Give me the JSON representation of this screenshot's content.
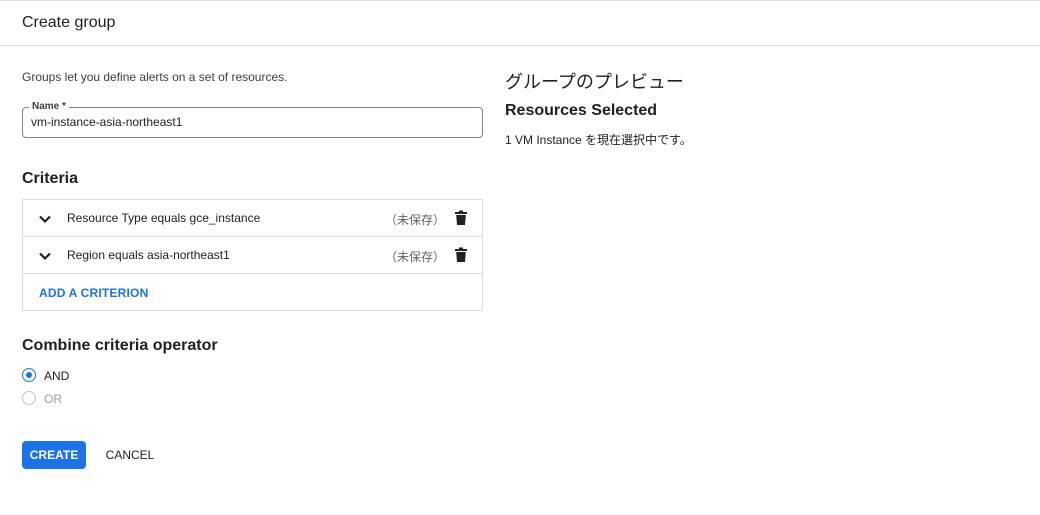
{
  "header": {
    "title": "Create group"
  },
  "form": {
    "description": "Groups let you define alerts on a set of resources.",
    "name_label": "Name *",
    "name_value": "vm-instance-asia-northeast1"
  },
  "criteria": {
    "title": "Criteria",
    "items": [
      {
        "label": "Resource Type equals gce_instance",
        "status": "（未保存）",
        "icon": "trash-icon"
      },
      {
        "label": "Region equals asia-northeast1",
        "status": "（未保存）",
        "icon": "trash-icon"
      }
    ],
    "add_label": "ADD A CRITERION"
  },
  "combine": {
    "title": "Combine criteria operator",
    "options": [
      {
        "label": "AND",
        "selected": true
      },
      {
        "label": "OR",
        "selected": false,
        "disabled": true
      }
    ]
  },
  "actions": {
    "create_label": "CREATE",
    "cancel_label": "CANCEL"
  },
  "preview": {
    "title": "グループのプレビュー",
    "resources_title": "Resources Selected",
    "resources_text": "1 VM Instance を現在選択中です。"
  },
  "colors": {
    "accent": "#1a73e8",
    "border": "#dadce0",
    "text": "#202124"
  }
}
